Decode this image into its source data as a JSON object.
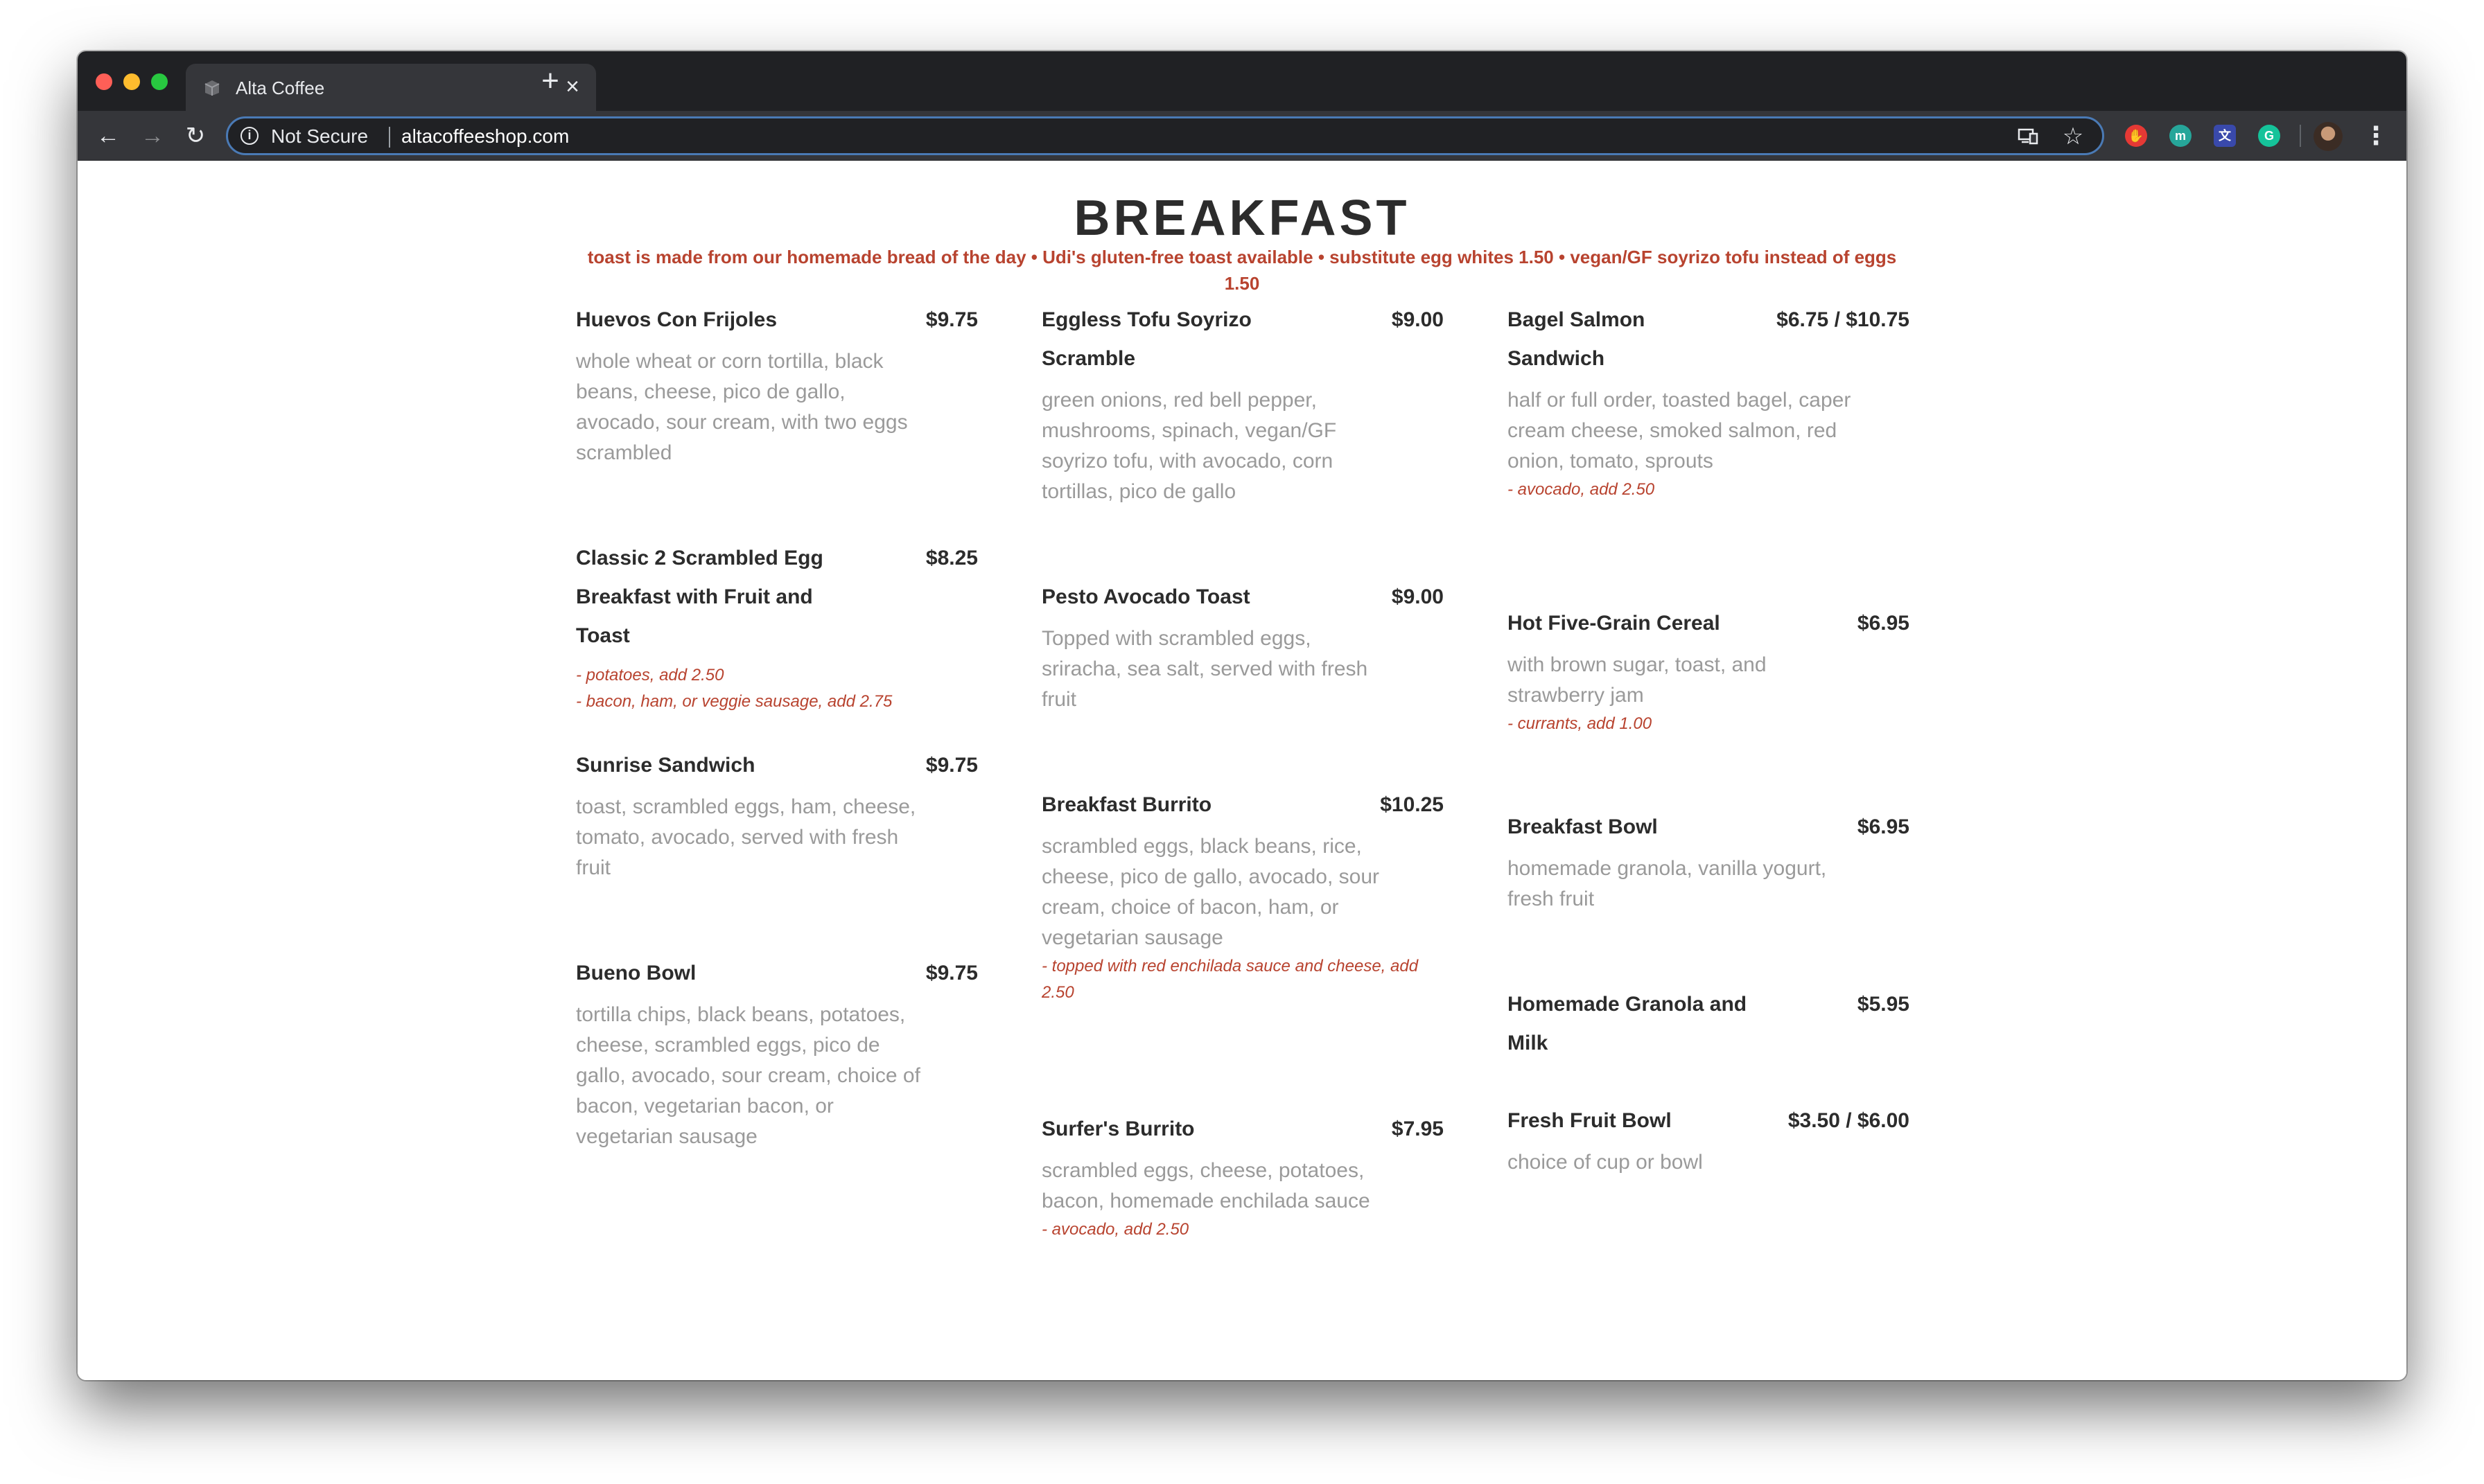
{
  "browser": {
    "tab_title": "Alta Coffee",
    "tab_close": "×",
    "new_tab": "+",
    "security_label": "Not Secure",
    "url": "altacoffeeshop.com",
    "nav": {
      "back": "←",
      "forward": "→",
      "reload": "↻"
    },
    "star": "☆",
    "menu": "⋮",
    "extensions": [
      {
        "icon": "stop-extension-icon",
        "glyph": "✋"
      },
      {
        "icon": "m-extension-icon",
        "glyph": "m"
      },
      {
        "icon": "translate-extension-icon",
        "glyph": "文"
      },
      {
        "icon": "grammarly-extension-icon",
        "glyph": "G"
      }
    ]
  },
  "menu": {
    "title": "BREAKFAST",
    "notes": "toast is made from our homemade bread of the day • Udi's gluten-free toast available • substitute egg whites 1.50 • vegan/GF soyrizo tofu instead of eggs 1.50",
    "columns": [
      [
        {
          "name": "Huevos Con Frijoles",
          "price": "$9.75",
          "description": "whole wheat or corn tortilla, black beans, cheese, pico de gallo, avocado, sour cream, with two eggs scrambled",
          "addons": []
        },
        {
          "name": "Classic 2 Scrambled Egg Breakfast with Fruit and Toast",
          "price": "$8.25",
          "description": "",
          "addons": [
            "- potatoes, add 2.50",
            "- bacon, ham, or veggie sausage, add 2.75"
          ]
        },
        {
          "name": "Sunrise Sandwich",
          "price": "$9.75",
          "description": "toast, scrambled eggs, ham, cheese, tomato, avocado, served with fresh fruit",
          "addons": []
        },
        {
          "name": "Bueno Bowl",
          "price": "$9.75",
          "description": "tortilla chips, black beans, potatoes, cheese, scrambled eggs, pico de gallo, avocado, sour cream, choice of bacon, vegetarian bacon, or vegetarian sausage",
          "addons": []
        }
      ],
      [
        {
          "name": "Eggless Tofu Soyrizo Scramble",
          "price": "$9.00",
          "description": "green onions, red bell pepper, mushrooms, spinach, vegan/GF soyrizo tofu, with avocado, corn tortillas, pico de gallo",
          "addons": []
        },
        {
          "name": "Pesto Avocado Toast",
          "price": "$9.00",
          "description": "Topped with scrambled eggs, sriracha, sea salt, served with fresh fruit",
          "addons": []
        },
        {
          "name": "Breakfast Burrito",
          "price": "$10.25",
          "description": "scrambled eggs, black beans, rice, cheese, pico de gallo, avocado, sour cream, choice of bacon, ham, or vegetarian sausage",
          "addons": [
            "- topped with red enchilada sauce and cheese, add 2.50"
          ]
        },
        {
          "name": "Surfer's Burrito",
          "price": "$7.95",
          "description": "scrambled eggs, cheese, potatoes, bacon, homemade enchilada sauce",
          "addons": [
            "- avocado, add 2.50"
          ]
        }
      ],
      [
        {
          "name": "Bagel Salmon Sandwich",
          "price": "$6.75 / $10.75",
          "description": "half or full order, toasted bagel, caper cream cheese, smoked salmon, red onion, tomato, sprouts",
          "addons": [
            "- avocado, add 2.50"
          ]
        },
        {
          "name": "Hot Five-Grain Cereal",
          "price": "$6.95",
          "description": "with brown sugar, toast, and strawberry jam",
          "addons": [
            "- currants, add 1.00"
          ]
        },
        {
          "name": "Breakfast Bowl",
          "price": "$6.95",
          "description": "homemade granola, vanilla yogurt, fresh fruit",
          "addons": []
        },
        {
          "name": "Homemade Granola and Milk",
          "price": "$5.95",
          "description": "",
          "addons": []
        },
        {
          "name": "Fresh Fruit Bowl",
          "price": "$3.50 / $6.00",
          "description": "choice of cup or bowl",
          "addons": []
        }
      ]
    ]
  }
}
